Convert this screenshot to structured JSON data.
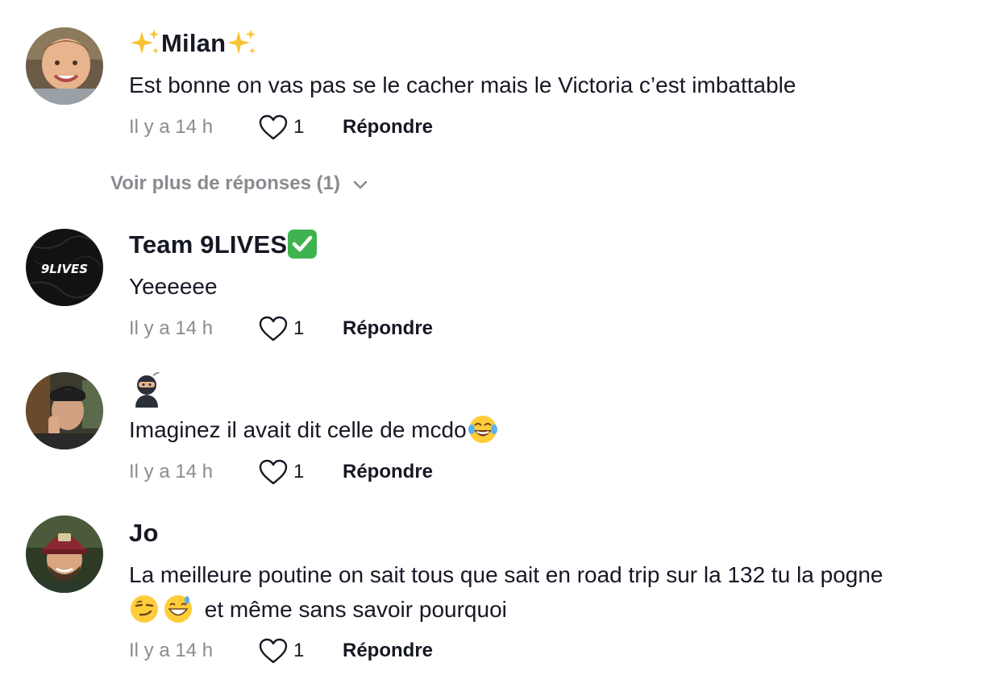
{
  "comments": [
    {
      "username": "Milan",
      "text": "Est bonne on vas pas se le cacher mais le Victoria c’est imbattable",
      "time": "Il y a 14 h",
      "likes": "1",
      "reply_label": "Répondre",
      "avatar_icon": "child-photo-avatar",
      "decor_icon": "sparkles-emoji"
    },
    {
      "username": "Team 9LIVES",
      "text": "Yeeeeee",
      "time": "Il y a 14 h",
      "likes": "1",
      "reply_label": "Répondre",
      "avatar_icon": "9lives-logo-avatar",
      "avatar_logo_text": "9LIVES",
      "badge_icon": "check-mark-emoji"
    },
    {
      "username": "",
      "text": "Imaginez il avait dit celle de mcdo",
      "time": "Il y a 14 h",
      "likes": "1",
      "reply_label": "Répondre",
      "avatar_icon": "person-photo-avatar",
      "username_icon": "ninja-emoji",
      "text_emoji": "tears-of-joy-emoji"
    },
    {
      "username": "Jo",
      "text_line1": "La meilleure poutine on sait tous que sait en road trip sur la 132 tu la pogne",
      "text_line2": "et même sans savoir pourquoi",
      "time": "Il y a 14 h",
      "likes": "1",
      "reply_label": "Répondre",
      "avatar_icon": "man-cap-photo-avatar",
      "line2_emojis": [
        "smirk-emoji",
        "grinning-sweat-emoji"
      ]
    }
  ],
  "more_replies": {
    "label": "Voir plus de réponses (1)",
    "icon": "chevron-down-icon"
  },
  "colors": {
    "text": "#161823",
    "muted": "#8a8b91",
    "background": "#ffffff"
  }
}
